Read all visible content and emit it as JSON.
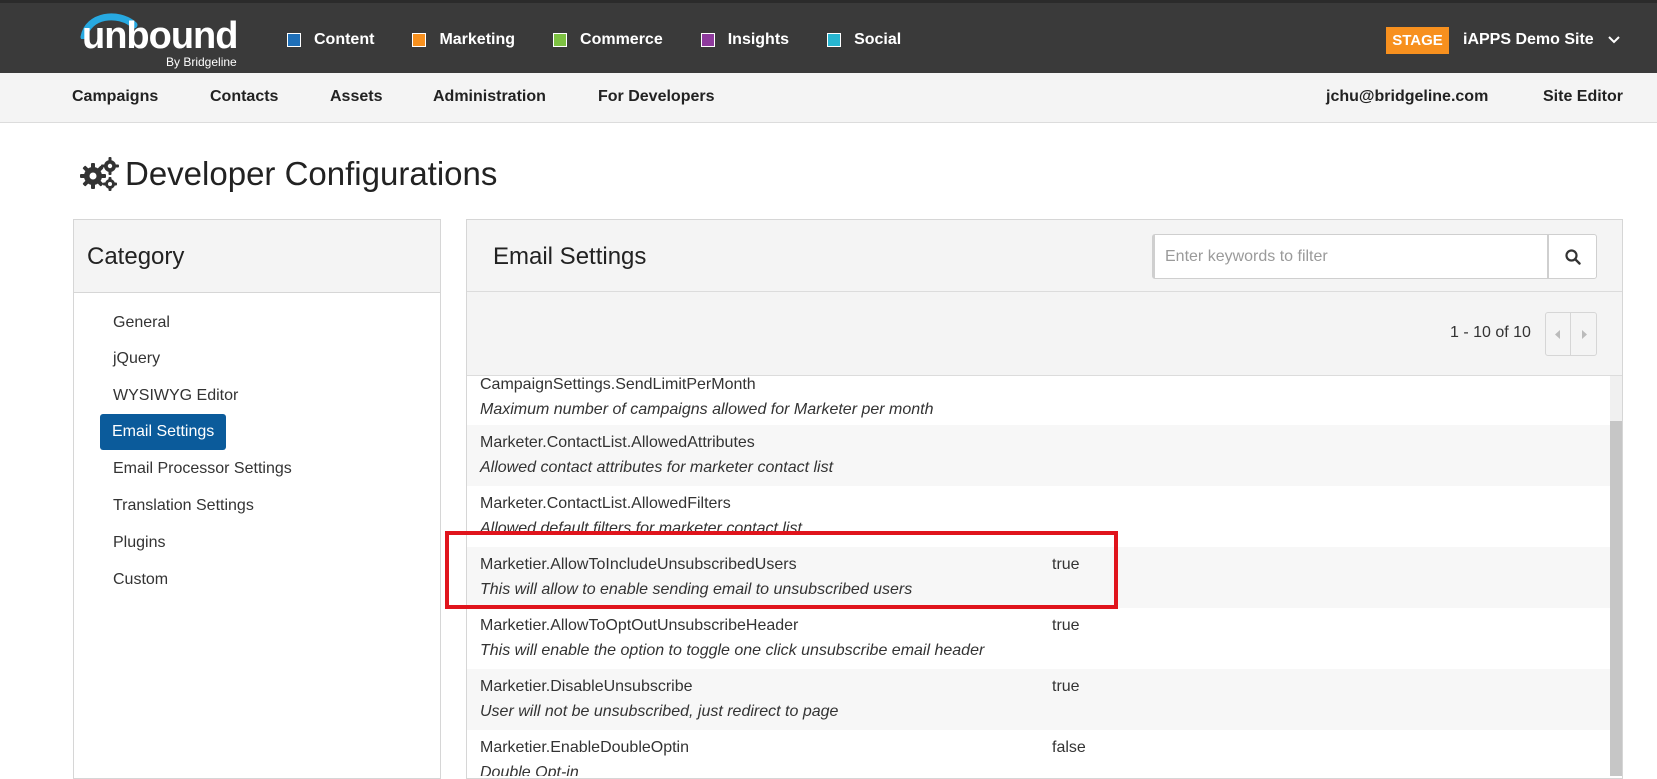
{
  "brand": {
    "logo_word": "unbound",
    "logo_sub": "By Bridgeline"
  },
  "app_nav": [
    {
      "label": "Content",
      "color": "#1e6fb8"
    },
    {
      "label": "Marketing",
      "color": "#f7901e"
    },
    {
      "label": "Commerce",
      "color": "#7dc142"
    },
    {
      "label": "Insights",
      "color": "#8e3a9d"
    },
    {
      "label": "Social",
      "color": "#27b6d1"
    }
  ],
  "site": {
    "stage_label": "STAGE",
    "stage_color": "#f7901e",
    "name": "iAPPS Demo Site",
    "dropdown_icon": "chevron-down-icon"
  },
  "sub_nav": {
    "items": [
      "Campaigns",
      "Contacts",
      "Assets",
      "Administration",
      "For Developers"
    ],
    "user_email": "jchu@bridgeline.com",
    "site_editor": "Site Editor"
  },
  "page": {
    "title": "Developer Configurations",
    "title_icon": "gears-icon"
  },
  "category": {
    "heading": "Category",
    "items": [
      "General",
      "jQuery",
      "WYSIWYG Editor",
      "Email Settings",
      "Email Processor Settings",
      "Translation Settings",
      "Plugins",
      "Custom"
    ],
    "active": "Email Settings",
    "active_color": "#0b5b9b"
  },
  "main": {
    "title": "Email Settings",
    "search_placeholder": "Enter keywords to filter",
    "search_icon": "search-icon",
    "pager_text": "1 - 10 of 10",
    "rows": [
      {
        "key": "CampaignSettings.SendLimitPerMonth",
        "desc": "Maximum number of campaigns allowed for Marketer per month",
        "value": ""
      },
      {
        "key": "Marketer.ContactList.AllowedAttributes",
        "desc": "Allowed contact attributes for marketer contact list",
        "value": ""
      },
      {
        "key": "Marketer.ContactList.AllowedFilters",
        "desc": "Allowed default filters for marketer contact list",
        "value": ""
      },
      {
        "key": "Marketier.AllowToIncludeUnsubscribedUsers",
        "desc": "This will allow to enable sending email to unsubscribed users",
        "value": "true"
      },
      {
        "key": "Marketier.AllowToOptOutUnsubscribeHeader",
        "desc": "This will enable the option to toggle one click unsubscribe email header",
        "value": "true"
      },
      {
        "key": "Marketier.DisableUnsubscribe",
        "desc": "User will not be unsubscribed, just redirect to page",
        "value": "true"
      },
      {
        "key": "Marketier.EnableDoubleOptin",
        "desc": "Double Opt-in",
        "value": "false"
      }
    ],
    "highlight_color": "#e0141c"
  }
}
